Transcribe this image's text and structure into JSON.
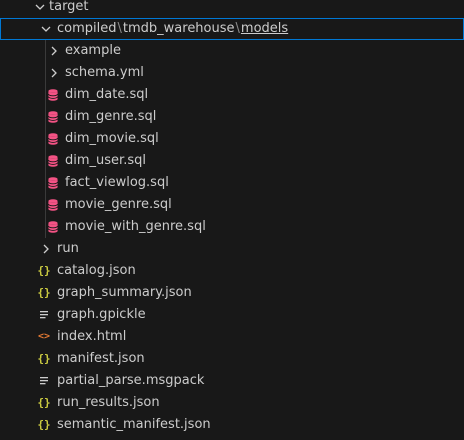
{
  "explorer": {
    "target": {
      "label": "target"
    },
    "path": {
      "segments": [
        "compiled",
        "tmdb_warehouse",
        "models"
      ],
      "separator": "\\"
    },
    "folders": [
      {
        "label": "example"
      },
      {
        "label": "schema.yml"
      }
    ],
    "sql_files": [
      "dim_date.sql",
      "dim_genre.sql",
      "dim_movie.sql",
      "dim_user.sql",
      "fact_viewlog.sql",
      "movie_genre.sql",
      "movie_with_genre.sql"
    ],
    "run_folder": {
      "label": "run"
    },
    "root_files": [
      {
        "label": "catalog.json",
        "icon": "json-icon"
      },
      {
        "label": "graph_summary.json",
        "icon": "json-icon"
      },
      {
        "label": "graph.gpickle",
        "icon": "lines-icon"
      },
      {
        "label": "index.html",
        "icon": "html-icon"
      },
      {
        "label": "manifest.json",
        "icon": "json-icon"
      },
      {
        "label": "partial_parse.msgpack",
        "icon": "lines-icon"
      },
      {
        "label": "run_results.json",
        "icon": "json-icon"
      },
      {
        "label": "semantic_manifest.json",
        "icon": "json-icon"
      }
    ]
  },
  "icon_glyphs": {
    "json": "{}",
    "html": "<>"
  },
  "colors": {
    "background": "#181818",
    "text": "#cccccc",
    "selection_border": "#0078d4",
    "database_icon": "#f55385",
    "json_icon": "#cbcb41",
    "html_icon": "#e37933",
    "indent_guide": "#3a3a3a"
  }
}
